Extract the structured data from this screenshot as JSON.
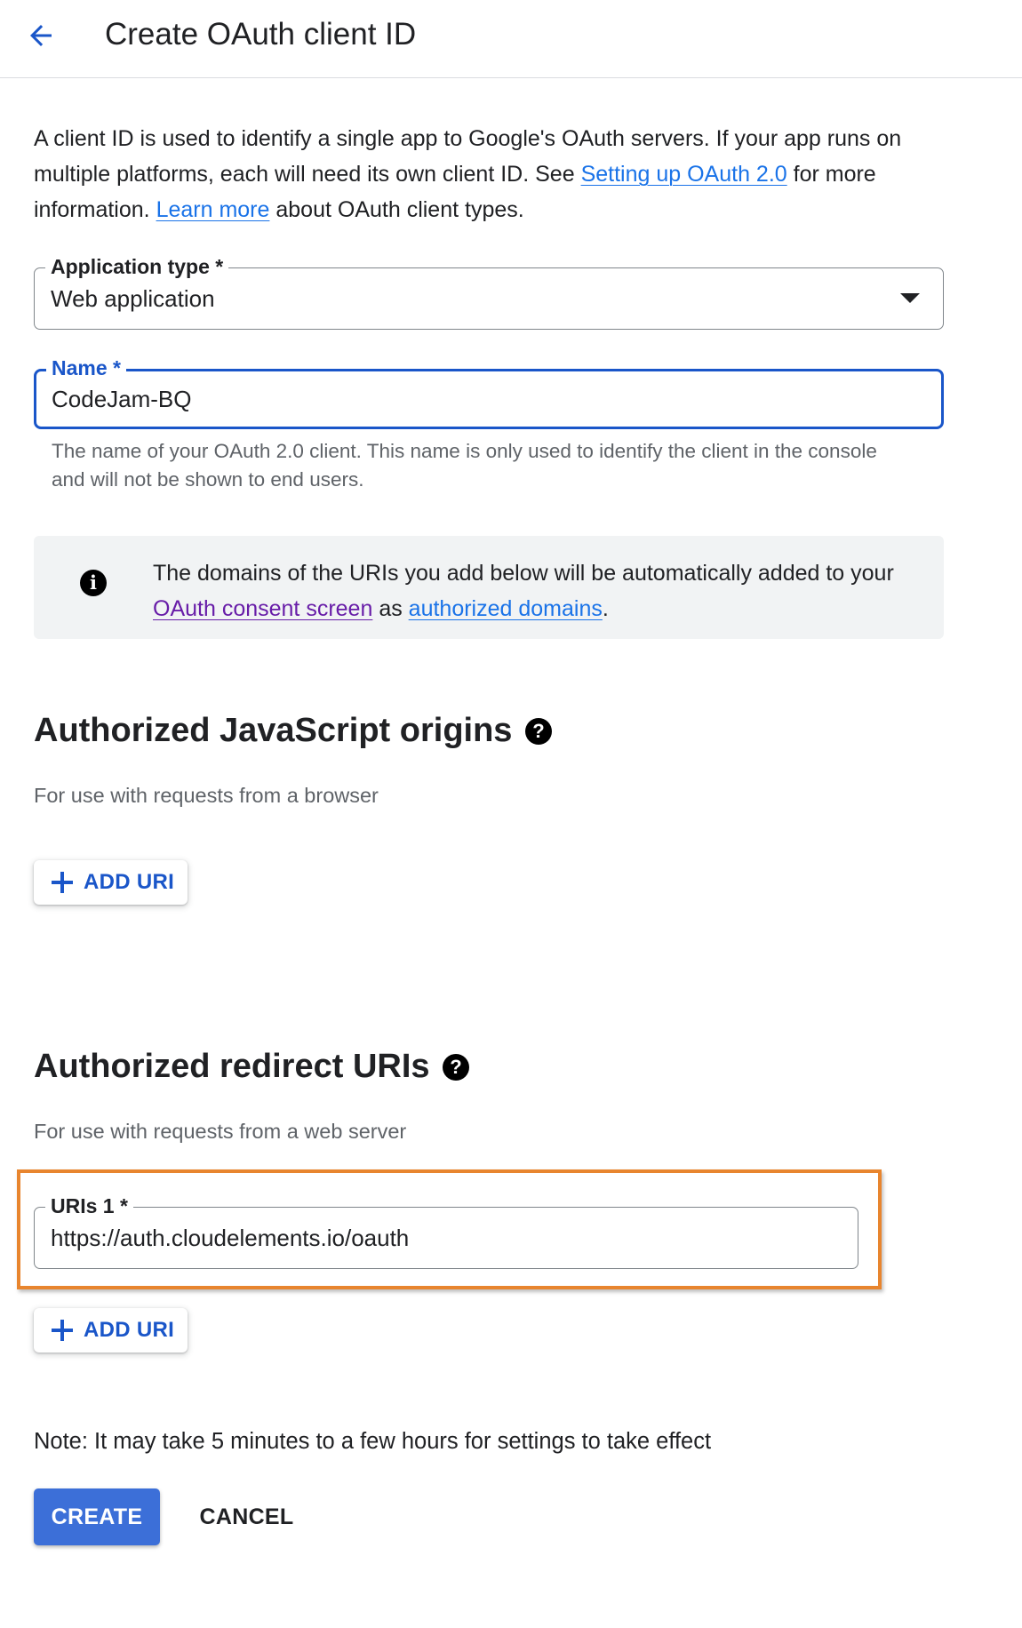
{
  "header": {
    "title": "Create OAuth client ID",
    "back_icon": "arrow-back-icon"
  },
  "intro": {
    "text_1": "A client ID is used to identify a single app to Google's OAuth servers. If your app runs on multiple platforms, each will need its own client ID. See ",
    "link_setup": "Setting up OAuth 2.0",
    "text_2": " for more information. ",
    "link_learn": "Learn more",
    "text_3": " about OAuth client types."
  },
  "application_type": {
    "label": "Application type *",
    "value": "Web application"
  },
  "name_field": {
    "label": "Name *",
    "value": "CodeJam-BQ",
    "helper": "The name of your OAuth 2.0 client. This name is only used to identify the client in the console and will not be shown to end users."
  },
  "info_box": {
    "text_1": "The domains of the URIs you add below will be automatically added to your ",
    "link_consent": "OAuth consent screen",
    "text_2": " as ",
    "link_domains": "authorized domains",
    "text_3": "."
  },
  "js_origins": {
    "title": "Authorized JavaScript origins",
    "subtitle": "For use with requests from a browser",
    "add_label": "ADD URI"
  },
  "redirect_uris": {
    "title": "Authorized redirect URIs",
    "subtitle": "For use with requests from a web server",
    "uri_label": "URIs 1 *",
    "uri_value": "https://auth.cloudelements.io/oauth",
    "add_label": "ADD URI"
  },
  "note": "Note: It may take 5 minutes to a few hours for settings to take effect",
  "actions": {
    "create": "CREATE",
    "cancel": "CANCEL"
  },
  "colors": {
    "accent_blue": "#1a56c9",
    "link_blue": "#1a73e8",
    "visited_link": "#681da8",
    "primary_button": "#3c6fd8",
    "highlight_orange": "#e8852e"
  }
}
